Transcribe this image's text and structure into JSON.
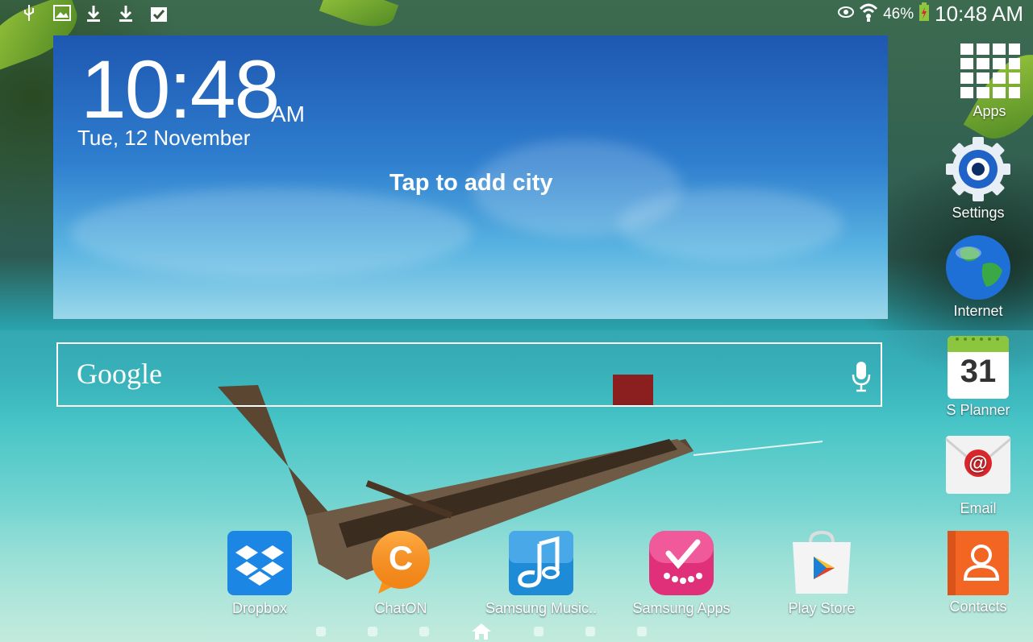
{
  "status_bar": {
    "battery": "46%",
    "time": "10:48 AM",
    "left_icons": [
      "usb-icon",
      "image-icon",
      "download-icon",
      "download-icon",
      "checkbox-icon"
    ],
    "right_icons": [
      "eye-icon",
      "wifi-icon",
      "battery-icon"
    ]
  },
  "widget": {
    "time": "10:48",
    "ampm": "AM",
    "date": "Tue, 12 November",
    "add_city": "Tap to add city"
  },
  "search": {
    "logo": "Google",
    "mic_icon": "mic-icon"
  },
  "right_dock": [
    {
      "label": "Apps",
      "icon": "apps-grid-icon"
    },
    {
      "label": "Settings",
      "icon": "settings-gear-icon"
    },
    {
      "label": "Internet",
      "icon": "globe-icon"
    },
    {
      "label": "S Planner",
      "icon": "calendar-icon",
      "day": "31"
    },
    {
      "label": "Email",
      "icon": "email-icon"
    },
    {
      "label": "Contacts",
      "icon": "contacts-icon"
    }
  ],
  "bottom_apps": [
    {
      "label": "Dropbox",
      "icon": "dropbox-icon"
    },
    {
      "label": "ChatON",
      "icon": "chaton-icon",
      "glyph": "C"
    },
    {
      "label": "Samsung Music..",
      "icon": "music-note-icon"
    },
    {
      "label": "Samsung Apps",
      "icon": "samsung-apps-icon"
    },
    {
      "label": "Play Store",
      "icon": "play-store-icon"
    }
  ],
  "pages": {
    "count": 7,
    "home_index": 3
  },
  "colors": {
    "widget_top": "#1e57b1",
    "widget_bottom": "#9ad7ea",
    "calendar_green": "#8cc63f",
    "contacts_orange": "#f26522",
    "chaton_orange": "#f7941d",
    "samsung_apps_pink": "#e0307a"
  }
}
